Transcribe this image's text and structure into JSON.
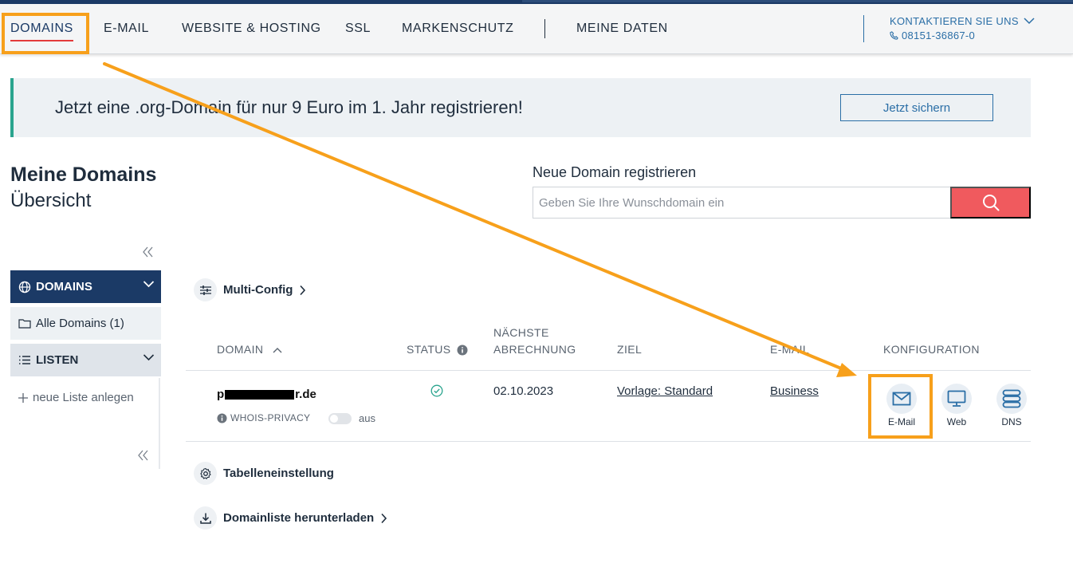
{
  "nav": {
    "items": [
      "DOMAINS",
      "E-MAIL",
      "WEBSITE & HOSTING",
      "SSL",
      "MARKENSCHUTZ",
      "MEINE DATEN"
    ],
    "contact_label": "KONTAKTIEREN SIE UNS",
    "contact_phone": "08151-36867-0"
  },
  "promo": {
    "text": "Jetzt eine .org-Domain für nur 9 Euro im 1. Jahr registrieren!",
    "button": "Jetzt sichern"
  },
  "page": {
    "title": "Meine Domains",
    "subtitle": "Übersicht"
  },
  "new_domain": {
    "label": "Neue Domain registrieren",
    "placeholder": "Geben Sie Ihre Wunschdomain ein"
  },
  "sidebar": {
    "domains_label": "DOMAINS",
    "all_domains_label": "Alle Domains (1)",
    "lists_label": "LISTEN",
    "new_list_label": "neue Liste anlegen"
  },
  "actions": {
    "multi_config": "Multi-Config",
    "table_settings": "Tabelleneinstellung",
    "download_list": "Domainliste herunterladen"
  },
  "table": {
    "headers": {
      "domain": "DOMAIN",
      "status": "STATUS",
      "billing_line1": "NÄCHSTE",
      "billing_line2": "ABRECHNUNG",
      "target": "ZIEL",
      "email": "E-MAIL",
      "config": "KONFIGURATION"
    },
    "rows": [
      {
        "domain_prefix": "p",
        "domain_suffix": "r.de",
        "whois_label": "WHOIS-PRIVACY",
        "whois_state": "aus",
        "billing": "02.10.2023",
        "target": "Vorlage: Standard",
        "email": "Business",
        "config": [
          "E-Mail",
          "Web",
          "DNS"
        ]
      }
    ]
  },
  "colors": {
    "brand_navy": "#1b3a66",
    "accent_blue": "#2a6ea6",
    "search_red": "#f05a5e",
    "highlight_orange": "#f7a01b",
    "promo_teal": "#2aa48e",
    "status_green": "#2aa48e"
  }
}
